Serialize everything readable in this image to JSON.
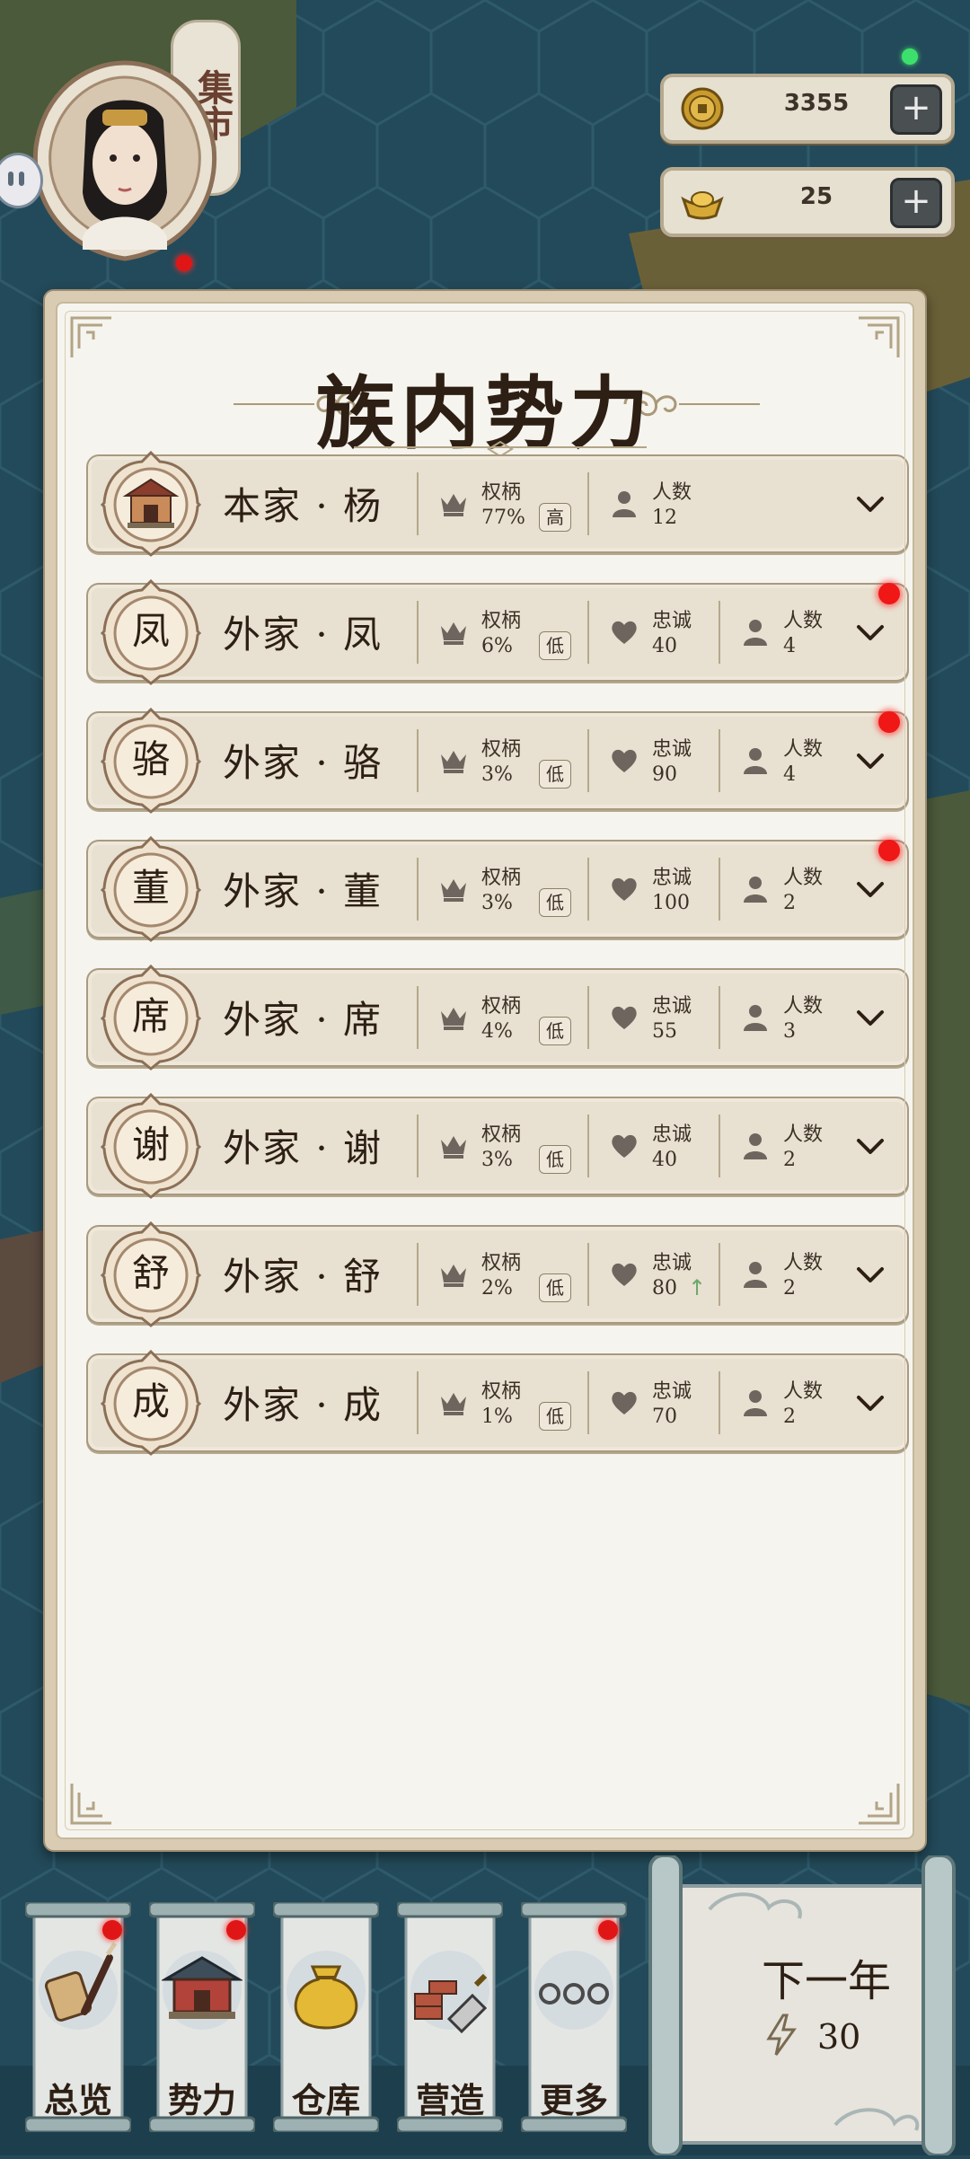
{
  "hud": {
    "side_tag": "集市",
    "coins": "3355",
    "ingots": "25",
    "plus": "+"
  },
  "panel": {
    "title": "族内势力"
  },
  "factions": [
    {
      "emblem": "",
      "name": "本家 · 杨",
      "power_label": "权柄",
      "power": "77%",
      "level": "高",
      "loyalty_label": "",
      "loyalty": "",
      "count_label": "人数",
      "count": "12",
      "alert": false,
      "trend": ""
    },
    {
      "emblem": "凤",
      "name": "外家 · 凤",
      "power_label": "权柄",
      "power": "6%",
      "level": "低",
      "loyalty_label": "忠诚",
      "loyalty": "40",
      "count_label": "人数",
      "count": "4",
      "alert": true,
      "trend": ""
    },
    {
      "emblem": "骆",
      "name": "外家 · 骆",
      "power_label": "权柄",
      "power": "3%",
      "level": "低",
      "loyalty_label": "忠诚",
      "loyalty": "90",
      "count_label": "人数",
      "count": "4",
      "alert": true,
      "trend": ""
    },
    {
      "emblem": "董",
      "name": "外家 · 董",
      "power_label": "权柄",
      "power": "3%",
      "level": "低",
      "loyalty_label": "忠诚",
      "loyalty": "100",
      "count_label": "人数",
      "count": "2",
      "alert": true,
      "trend": ""
    },
    {
      "emblem": "席",
      "name": "外家 · 席",
      "power_label": "权柄",
      "power": "4%",
      "level": "低",
      "loyalty_label": "忠诚",
      "loyalty": "55",
      "count_label": "人数",
      "count": "3",
      "alert": false,
      "trend": ""
    },
    {
      "emblem": "谢",
      "name": "外家 · 谢",
      "power_label": "权柄",
      "power": "3%",
      "level": "低",
      "loyalty_label": "忠诚",
      "loyalty": "40",
      "count_label": "人数",
      "count": "2",
      "alert": false,
      "trend": ""
    },
    {
      "emblem": "舒",
      "name": "外家 · 舒",
      "power_label": "权柄",
      "power": "2%",
      "level": "低",
      "loyalty_label": "忠诚",
      "loyalty": "80",
      "count_label": "人数",
      "count": "2",
      "alert": false,
      "trend": "↑"
    },
    {
      "emblem": "成",
      "name": "外家 · 成",
      "power_label": "权柄",
      "power": "1%",
      "level": "低",
      "loyalty_label": "忠诚",
      "loyalty": "70",
      "count_label": "人数",
      "count": "2",
      "alert": false,
      "trend": ""
    }
  ],
  "nav": [
    {
      "label": "总览",
      "icon": "scroll-brush-icon",
      "alert": true
    },
    {
      "label": "势力",
      "icon": "temple-icon",
      "alert": true
    },
    {
      "label": "仓库",
      "icon": "sack-icon",
      "alert": false
    },
    {
      "label": "营造",
      "icon": "bricks-trowel-icon",
      "alert": false
    },
    {
      "label": "更多",
      "icon": "more-dots-icon",
      "alert": true
    }
  ],
  "next_year": {
    "label": "下一年",
    "energy": "30",
    "icon": "lightning-icon"
  },
  "colors": {
    "panel_bg": "#f6f4ee",
    "row_bg": "#e8e0d0",
    "text_dark": "#2d1f14",
    "alert_red": "#f01717",
    "sea": "#234a5a"
  }
}
